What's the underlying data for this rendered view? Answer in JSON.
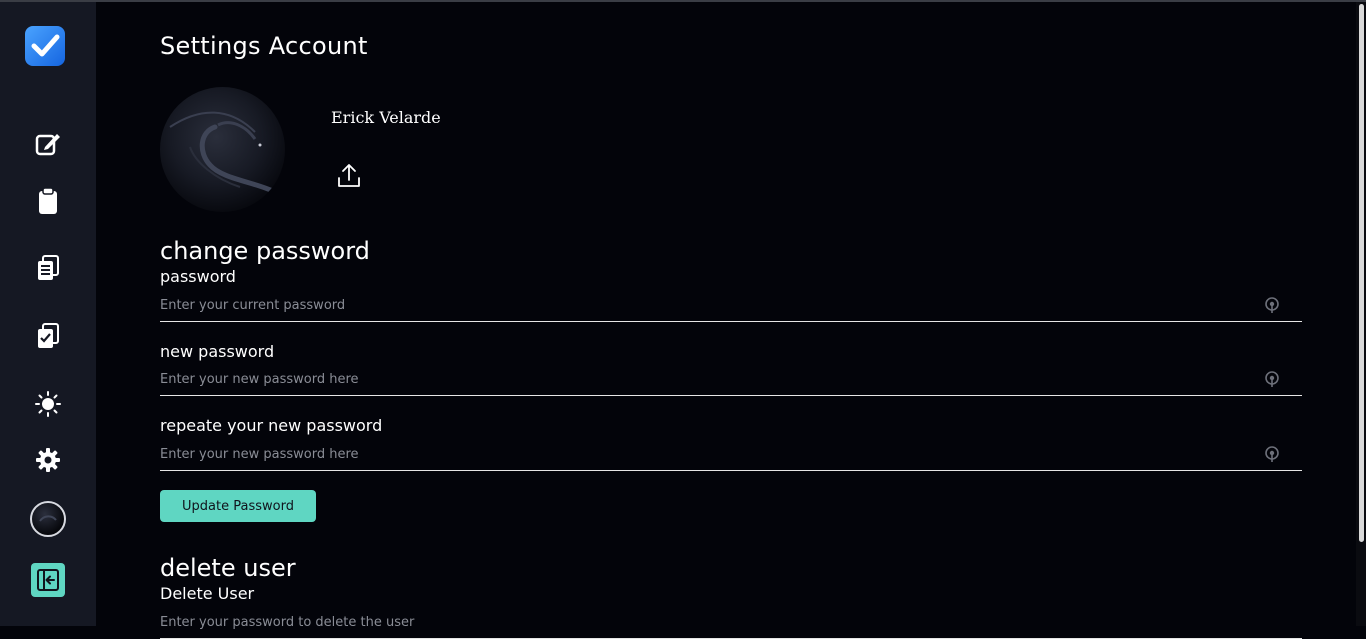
{
  "page": {
    "title": "Settings Account"
  },
  "profile": {
    "name": "Erick Velarde"
  },
  "change_password": {
    "title": "change password",
    "fields": [
      {
        "label": "password",
        "placeholder": "Enter your current password"
      },
      {
        "label": "new password",
        "placeholder": "Enter your new password here"
      },
      {
        "label": "repeate your new password",
        "placeholder": "Enter your new password here"
      }
    ],
    "button_label": "Update Password"
  },
  "delete_user": {
    "title": "delete user",
    "label": "Delete User",
    "placeholder": "Enter your password to delete the user"
  },
  "sidebar": {
    "items": [
      "logo-icon",
      "edit-icon",
      "clipboard-icon",
      "task-list-icon",
      "checked-tasks-icon",
      "sun-icon",
      "gear-icon",
      "avatar",
      "logout-icon"
    ]
  },
  "colors": {
    "accent": "#5fd6c2",
    "sidebar_bg": "#151823",
    "page_bg": "#03040a"
  }
}
